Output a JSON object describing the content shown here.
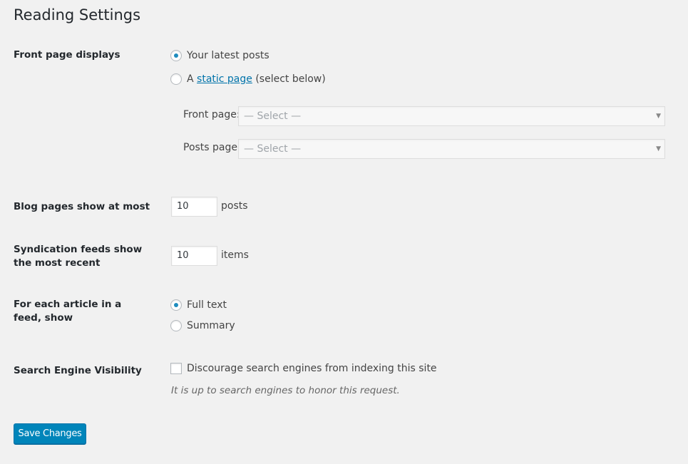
{
  "page_title": "Reading Settings",
  "front_page": {
    "label": "Front page displays",
    "option_latest": "Your latest posts",
    "option_static_prefix": "A ",
    "option_static_link": "static page",
    "option_static_suffix": " (select below)",
    "selected": "latest",
    "front_page_label": "Front page:",
    "front_page_value": "— Select —",
    "posts_page_label": "Posts page:",
    "posts_page_value": "— Select —"
  },
  "blog_pages": {
    "label": "Blog pages show at most",
    "value": "10",
    "suffix": "posts"
  },
  "syndication": {
    "label": "Syndication feeds show the most recent",
    "value": "10",
    "suffix": "items"
  },
  "feed_article": {
    "label": "For each article in a feed, show",
    "option_full": "Full text",
    "option_summary": "Summary",
    "selected": "full"
  },
  "search_engine": {
    "label": "Search Engine Visibility",
    "checkbox_label": "Discourage search engines from indexing this site",
    "checked": false,
    "description": "It is up to search engines to honor this request."
  },
  "save_button": "Save Changes",
  "colors": {
    "accent": "#0085ba",
    "link": "#0073aa",
    "radio_dot": "#1e8cbe",
    "background": "#f1f1f1"
  }
}
